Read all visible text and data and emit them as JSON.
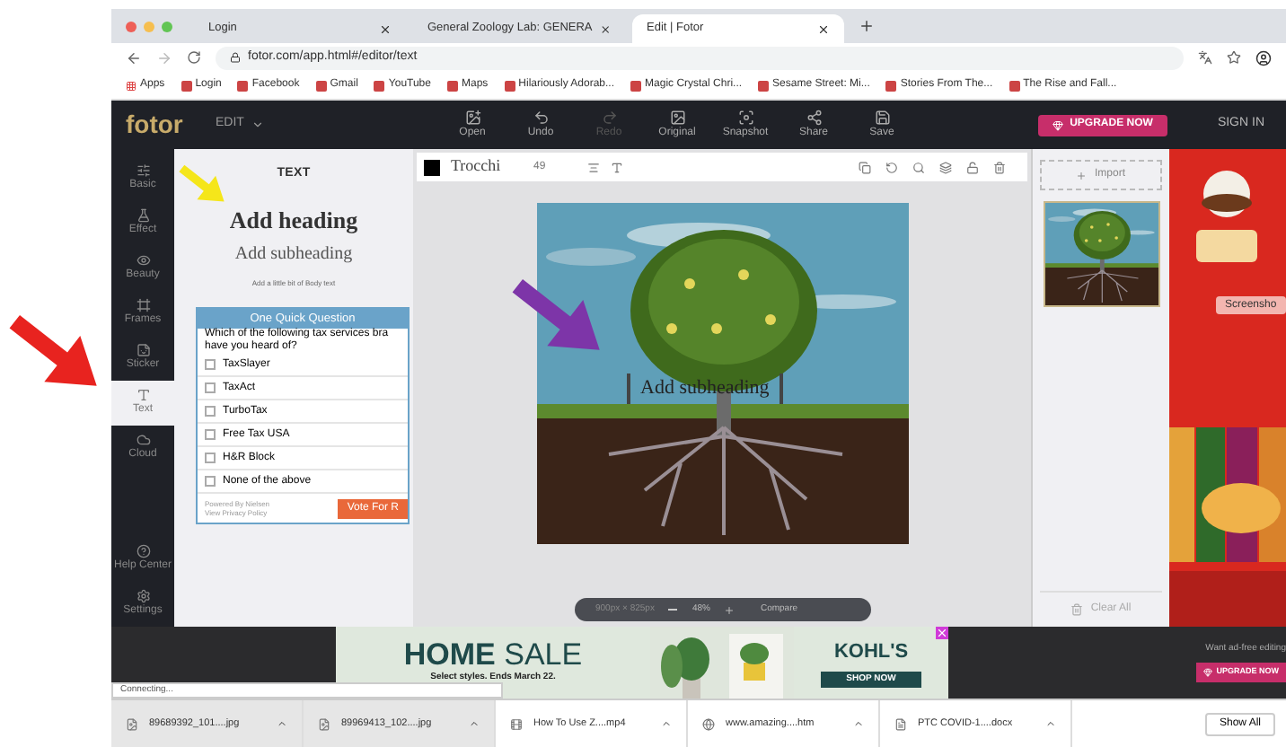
{
  "browser": {
    "tabs": [
      {
        "title": "Login",
        "selected": false
      },
      {
        "title": "General Zoology Lab: GENERA",
        "selected": false
      },
      {
        "title": "Edit | Fotor",
        "selected": true
      }
    ],
    "address": "fotor.com/app.html#/editor/text",
    "bookmarks": [
      "Apps",
      "Login",
      "Facebook",
      "Gmail",
      "YouTube",
      "Maps",
      "Hilariously Adorab...",
      "Magic Crystal Chri...",
      "Sesame Street: Mi...",
      "Stories From The...",
      "The Rise and Fall..."
    ]
  },
  "header": {
    "logo": "fotor",
    "mode": "EDIT",
    "tools": [
      {
        "label": "Open",
        "disabled": false
      },
      {
        "label": "Undo",
        "disabled": false
      },
      {
        "label": "Redo",
        "disabled": true
      },
      {
        "label": "Original",
        "disabled": false
      },
      {
        "label": "Snapshot",
        "disabled": false
      },
      {
        "label": "Share",
        "disabled": false
      },
      {
        "label": "Save",
        "disabled": false
      }
    ],
    "upgrade": "UPGRADE NOW",
    "sign_in": "SIGN IN"
  },
  "sidebar": {
    "items": [
      {
        "label": "Basic",
        "selected": false
      },
      {
        "label": "Effect",
        "selected": false
      },
      {
        "label": "Beauty",
        "selected": false
      },
      {
        "label": "Frames",
        "selected": false
      },
      {
        "label": "Sticker",
        "selected": false
      },
      {
        "label": "Text",
        "selected": true
      },
      {
        "label": "Cloud",
        "selected": false
      }
    ],
    "bottom_items": [
      {
        "label": "Help Center",
        "selected": false
      },
      {
        "label": "Settings",
        "selected": false
      }
    ]
  },
  "text_panel": {
    "title": "TEXT",
    "heading": "Add heading",
    "subheading": "Add subheading",
    "body": "Add a little bit of Body text"
  },
  "poll": {
    "title": "One Quick Question",
    "question_lines": [
      "Which of the following tax services bra",
      "have you heard of?"
    ],
    "options": [
      {
        "label": "TaxSlayer",
        "checked": false
      },
      {
        "label": "TaxAct",
        "checked": false
      },
      {
        "label": "TurboTax",
        "checked": false
      },
      {
        "label": "Free Tax USA",
        "checked": false
      },
      {
        "label": "H&R Block",
        "checked": false
      },
      {
        "label": "None of the above",
        "checked": false
      }
    ],
    "powered_by": "Powered By Nielsen",
    "privacy": "View Privacy Policy",
    "vote": "Vote For R"
  },
  "text_toolbar": {
    "font": "Trocchi",
    "size": "49"
  },
  "canvas": {
    "text_box": "Add subheading",
    "dimensions": "900px × 825px",
    "zoom": "48%",
    "compare": "Compare"
  },
  "assets": {
    "import": "Import",
    "clear": "Clear All"
  },
  "side_ad": {
    "button": "Screensho",
    "note": "Want ad-free editing",
    "upgrade": "UPGRADE NOW"
  },
  "banner_ad": {
    "title_bold": "HOME",
    "title_light": "SALE",
    "subtitle": "Select styles. Ends March 22.",
    "brand": "KOHL'S",
    "cta": "SHOP NOW"
  },
  "status": "Connecting...",
  "downloads": {
    "files": [
      "89689392_101....jpg",
      "89969413_102....jpg",
      "How To Use Z....mp4",
      "www.amazing....htm",
      "PTC COVID-1....docx"
    ],
    "show_all": "Show All"
  }
}
